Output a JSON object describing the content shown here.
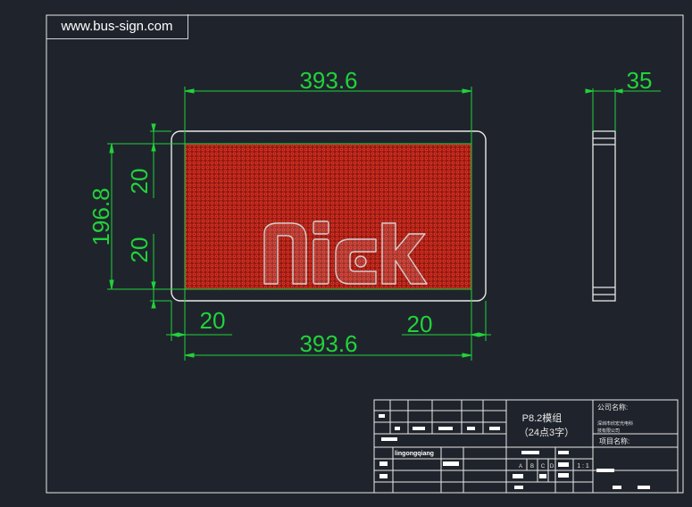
{
  "watermark": "www.bus-sign.com",
  "colors": {
    "background": "#1f242c",
    "dimension": "#22d23a",
    "outline": "#e8e8e8",
    "led_panel": "#8e1a12",
    "led_dot": "#ff3a28"
  },
  "dimensions": {
    "top_width": "393.6",
    "bottom_width": "393.6",
    "depth": "35",
    "height": "196.8",
    "upper_half": "20",
    "lower_half": "20",
    "left_margin": "20",
    "right_margin": "20"
  },
  "logo_text": "Nick",
  "title_block": {
    "product_line1": "P8.2模组",
    "product_line2": "（24点3字）",
    "company_label": "公司名称:",
    "company_line1": "深圳市欣宏光电科",
    "company_line2": "技有限公司",
    "project_label": "项目名称:",
    "designer": "lingongqiang",
    "revision_letters": [
      "A",
      "B",
      "C",
      "D"
    ],
    "scale": "1 : 1"
  }
}
